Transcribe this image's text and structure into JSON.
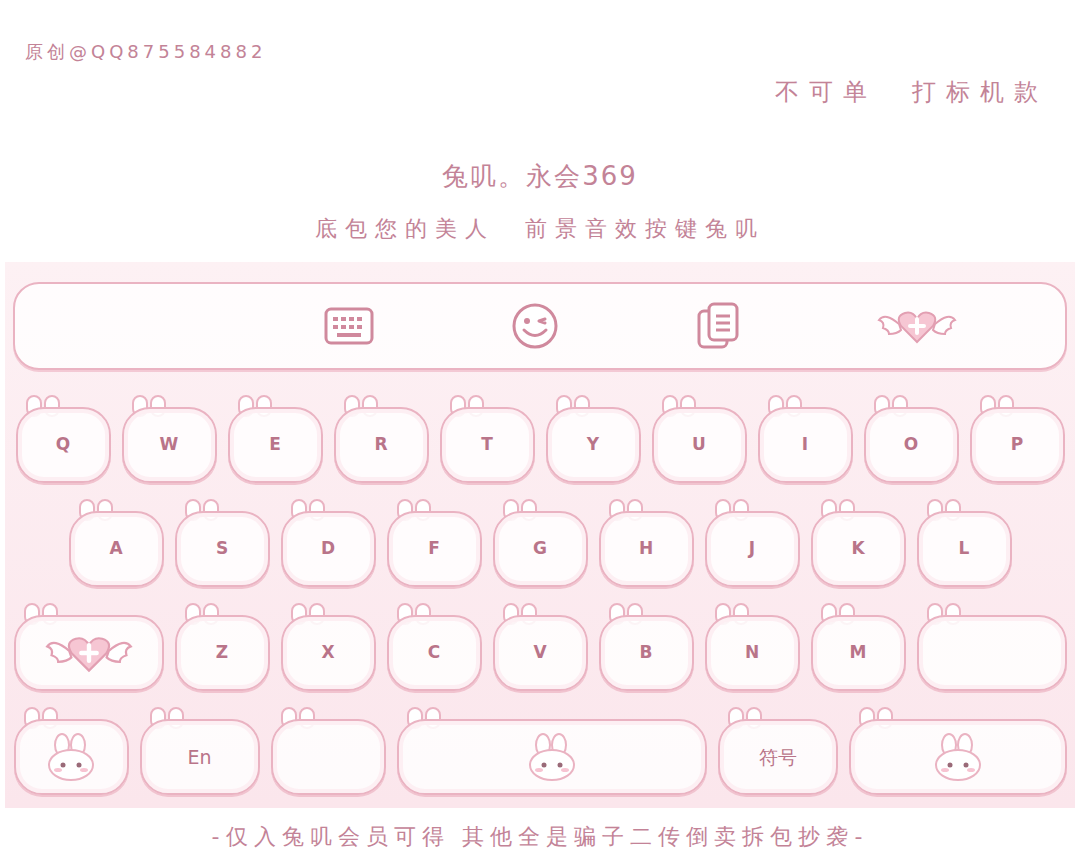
{
  "header": {
    "credit": "原创@QQ875584882",
    "note": "不可单  打标机款",
    "title": "兔叽。永会369",
    "subtitle": "底包您的美人  前景音效按键兔叽"
  },
  "keyboard": {
    "rows": [
      [
        {
          "kind": "letter",
          "label": "Q"
        },
        {
          "kind": "letter",
          "label": "W"
        },
        {
          "kind": "letter",
          "label": "E"
        },
        {
          "kind": "letter",
          "label": "R"
        },
        {
          "kind": "letter",
          "label": "T"
        },
        {
          "kind": "letter",
          "label": "Y"
        },
        {
          "kind": "letter",
          "label": "U"
        },
        {
          "kind": "letter",
          "label": "I"
        },
        {
          "kind": "letter",
          "label": "O"
        },
        {
          "kind": "letter",
          "label": "P"
        }
      ],
      [
        {
          "kind": "letter",
          "label": "A"
        },
        {
          "kind": "letter",
          "label": "S"
        },
        {
          "kind": "letter",
          "label": "D"
        },
        {
          "kind": "letter",
          "label": "F"
        },
        {
          "kind": "letter",
          "label": "G"
        },
        {
          "kind": "letter",
          "label": "H"
        },
        {
          "kind": "letter",
          "label": "J"
        },
        {
          "kind": "letter",
          "label": "K"
        },
        {
          "kind": "letter",
          "label": "L"
        }
      ],
      [
        {
          "kind": "shift"
        },
        {
          "kind": "letter",
          "label": "Z"
        },
        {
          "kind": "letter",
          "label": "X"
        },
        {
          "kind": "letter",
          "label": "C"
        },
        {
          "kind": "letter",
          "label": "V"
        },
        {
          "kind": "letter",
          "label": "B"
        },
        {
          "kind": "letter",
          "label": "N"
        },
        {
          "kind": "letter",
          "label": "M"
        },
        {
          "kind": "delete"
        }
      ],
      [
        {
          "kind": "mode"
        },
        {
          "kind": "lang",
          "label": "En"
        },
        {
          "kind": "comma"
        },
        {
          "kind": "space"
        },
        {
          "kind": "symbol",
          "label": "符号"
        },
        {
          "kind": "enter"
        }
      ]
    ]
  },
  "footer": "-仅入兔叽会员可得 其他全是骗子二传倒卖拆包抄袭-"
}
